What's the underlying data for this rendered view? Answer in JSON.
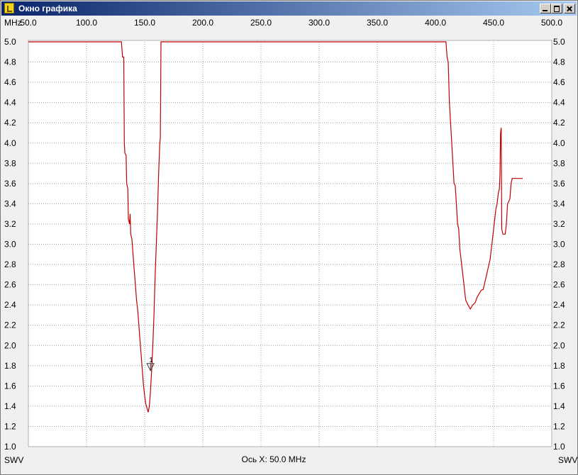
{
  "window": {
    "title": "Окно графика"
  },
  "chart_data": {
    "type": "line",
    "xlabel": "MHz",
    "ylabel": "SWV",
    "xlim": [
      50,
      500
    ],
    "ylim": [
      1.0,
      5.0
    ],
    "x_ticks": [
      "50.0",
      "100.0",
      "150.0",
      "200.0",
      "250.0",
      "300.0",
      "350.0",
      "400.0",
      "450.0",
      "500.0"
    ],
    "y_ticks": [
      "1.0",
      "1.2",
      "1.4",
      "1.6",
      "1.8",
      "2.0",
      "2.2",
      "2.4",
      "2.6",
      "2.8",
      "3.0",
      "3.2",
      "3.4",
      "3.6",
      "3.8",
      "4.0",
      "4.2",
      "4.4",
      "4.6",
      "4.8",
      "5.0"
    ],
    "grid": true,
    "status": "Ось X: 50.0 MHz",
    "marker": {
      "label": "1",
      "x": 155,
      "y": 1.8
    },
    "series": [
      {
        "color": "#c00000",
        "points": [
          [
            50,
            5.0
          ],
          [
            130,
            5.0
          ],
          [
            131,
            4.85
          ],
          [
            132,
            4.85
          ],
          [
            132.5,
            4.0
          ],
          [
            133,
            3.9
          ],
          [
            134,
            3.88
          ],
          [
            134.5,
            3.6
          ],
          [
            135.5,
            3.55
          ],
          [
            136,
            3.25
          ],
          [
            137,
            3.2
          ],
          [
            137.5,
            3.3
          ],
          [
            138,
            3.1
          ],
          [
            139,
            3.05
          ],
          [
            140,
            2.9
          ],
          [
            141,
            2.75
          ],
          [
            142,
            2.6
          ],
          [
            143,
            2.45
          ],
          [
            144,
            2.35
          ],
          [
            145,
            2.2
          ],
          [
            146,
            2.05
          ],
          [
            147,
            1.9
          ],
          [
            148,
            1.75
          ],
          [
            149,
            1.6
          ],
          [
            150,
            1.5
          ],
          [
            151,
            1.42
          ],
          [
            152,
            1.38
          ],
          [
            153,
            1.34
          ],
          [
            154,
            1.4
          ],
          [
            155,
            1.55
          ],
          [
            156,
            1.75
          ],
          [
            157,
            2.0
          ],
          [
            158,
            2.3
          ],
          [
            159,
            2.7
          ],
          [
            160,
            3.0
          ],
          [
            161,
            3.3
          ],
          [
            162,
            3.7
          ],
          [
            163,
            4.0
          ],
          [
            163.5,
            4.05
          ],
          [
            164,
            5.0
          ],
          [
            409,
            5.0
          ],
          [
            410,
            4.85
          ],
          [
            411,
            4.8
          ],
          [
            412,
            4.4
          ],
          [
            413,
            4.2
          ],
          [
            414,
            4.0
          ],
          [
            415,
            3.8
          ],
          [
            416,
            3.6
          ],
          [
            417,
            3.58
          ],
          [
            418,
            3.4
          ],
          [
            419,
            3.2
          ],
          [
            420,
            3.15
          ],
          [
            421,
            2.95
          ],
          [
            422,
            2.85
          ],
          [
            423,
            2.75
          ],
          [
            424,
            2.65
          ],
          [
            425,
            2.55
          ],
          [
            426,
            2.45
          ],
          [
            428,
            2.4
          ],
          [
            429,
            2.38
          ],
          [
            430,
            2.36
          ],
          [
            431,
            2.38
          ],
          [
            432,
            2.4
          ],
          [
            434,
            2.42
          ],
          [
            435,
            2.45
          ],
          [
            436,
            2.48
          ],
          [
            437,
            2.5
          ],
          [
            438,
            2.52
          ],
          [
            439,
            2.54
          ],
          [
            440,
            2.55
          ],
          [
            441,
            2.55
          ],
          [
            442,
            2.6
          ],
          [
            443,
            2.65
          ],
          [
            444,
            2.7
          ],
          [
            445,
            2.75
          ],
          [
            447,
            2.85
          ],
          [
            448,
            2.95
          ],
          [
            449,
            3.05
          ],
          [
            450,
            3.15
          ],
          [
            451,
            3.25
          ],
          [
            452,
            3.35
          ],
          [
            453,
            3.4
          ],
          [
            454,
            3.5
          ],
          [
            455,
            3.55
          ],
          [
            455.5,
            3.7
          ],
          [
            456,
            4.1
          ],
          [
            456.5,
            4.15
          ],
          [
            457,
            3.15
          ],
          [
            458,
            3.1
          ],
          [
            460,
            3.1
          ],
          [
            461,
            3.2
          ],
          [
            462,
            3.4
          ],
          [
            463,
            3.42
          ],
          [
            464,
            3.45
          ],
          [
            465,
            3.6
          ],
          [
            466,
            3.65
          ],
          [
            475,
            3.65
          ]
        ]
      }
    ]
  }
}
